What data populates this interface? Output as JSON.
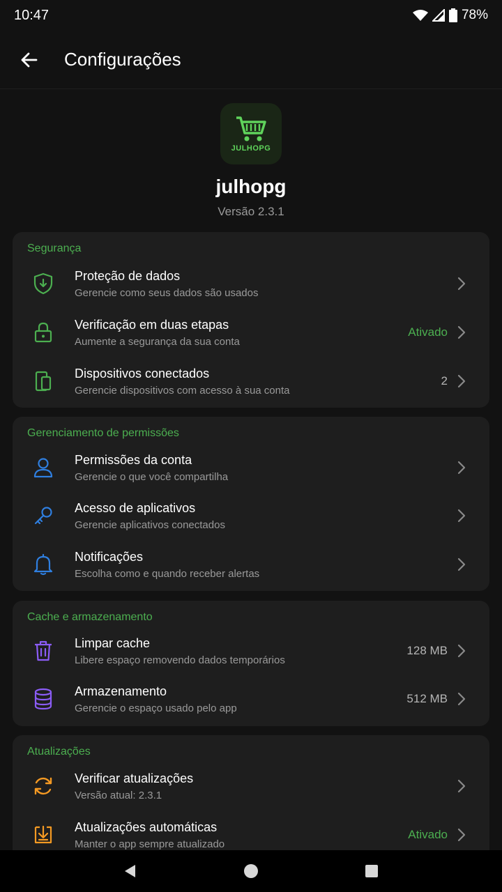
{
  "status": {
    "time": "10:47",
    "battery": "78%"
  },
  "app_bar": {
    "title": "Configurações"
  },
  "header": {
    "logo_text": "JULHOPG",
    "app_name": "julhopg",
    "version": "Versão 2.3.1"
  },
  "sections": [
    {
      "title": "Segurança",
      "items": [
        {
          "title": "Proteção de dados",
          "subtitle": "Gerencie como seus dados são usados",
          "value": ""
        },
        {
          "title": "Verificação em duas etapas",
          "subtitle": "Aumente a segurança da sua conta",
          "value": "Ativado"
        },
        {
          "title": "Dispositivos conectados",
          "subtitle": "Gerencie dispositivos com acesso à sua conta",
          "value": "2"
        }
      ]
    },
    {
      "title": "Gerenciamento de permissões",
      "items": [
        {
          "title": "Permissões da conta",
          "subtitle": "Gerencie o que você compartilha",
          "value": ""
        },
        {
          "title": "Acesso de aplicativos",
          "subtitle": "Gerencie aplicativos conectados",
          "value": ""
        },
        {
          "title": "Notificações",
          "subtitle": "Escolha como e quando receber alertas",
          "value": ""
        }
      ]
    },
    {
      "title": "Cache e armazenamento",
      "items": [
        {
          "title": "Limpar cache",
          "subtitle": "Libere espaço removendo dados temporários",
          "value": "128 MB"
        },
        {
          "title": "Armazenamento",
          "subtitle": "Gerencie o espaço usado pelo app",
          "value": "512 MB"
        }
      ]
    },
    {
      "title": "Atualizações",
      "items": [
        {
          "title": "Verificar atualizações",
          "subtitle": "Versão atual: 2.3.1",
          "value": ""
        },
        {
          "title": "Atualizações automáticas",
          "subtitle": "Manter o app sempre atualizado",
          "value": "Ativado"
        }
      ]
    }
  ],
  "colors": {
    "accent_green": "#4caf50",
    "icon_blue": "#2f7fe0",
    "icon_purple": "#8b5cf6",
    "icon_orange": "#f59a23"
  },
  "icons": [
    "back-arrow",
    "shield",
    "lock",
    "devices",
    "user",
    "key",
    "bell",
    "trash",
    "database",
    "refresh",
    "download",
    "chevron-right"
  ]
}
